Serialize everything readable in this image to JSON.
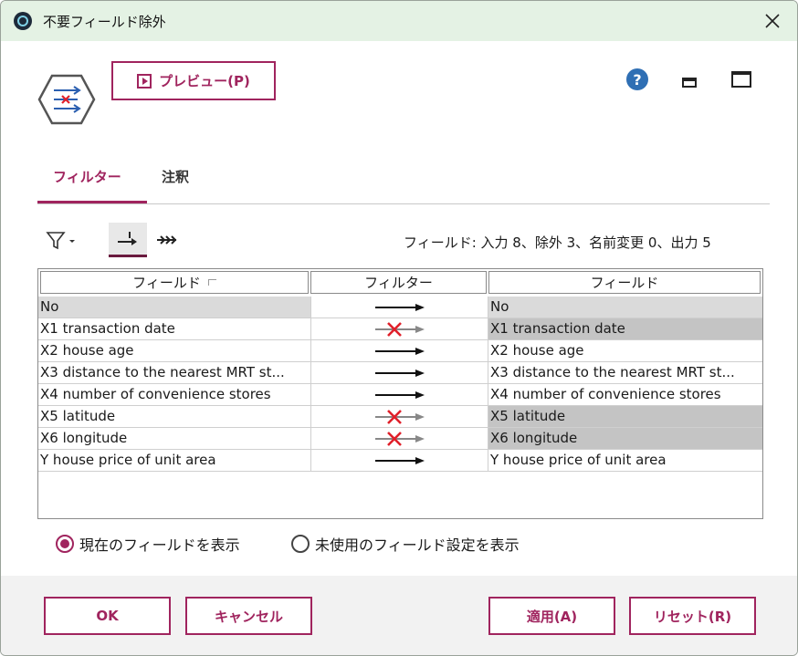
{
  "window": {
    "title": "不要フィールド除外"
  },
  "toolbar": {
    "preview_label": "プレビュー(P)",
    "help_glyph": "?"
  },
  "tabs": [
    {
      "label": "フィルター",
      "active": true
    },
    {
      "label": "注釈",
      "active": false
    }
  ],
  "summary": "フィールド: 入力 8、除外 3、名前変更 0、出力 5",
  "table": {
    "headers": [
      "フィールド",
      "フィルター",
      "フィールド"
    ],
    "rows": [
      {
        "input": "No",
        "excluded": false,
        "output": "No"
      },
      {
        "input": "X1 transaction date",
        "excluded": true,
        "output": "X1 transaction date"
      },
      {
        "input": "X2 house age",
        "excluded": false,
        "output": "X2 house age"
      },
      {
        "input": "X3 distance to the nearest MRT st...",
        "excluded": false,
        "output": "X3 distance to the nearest MRT st..."
      },
      {
        "input": "X4 number of convenience stores",
        "excluded": false,
        "output": "X4 number of convenience stores"
      },
      {
        "input": "X5 latitude",
        "excluded": true,
        "output": "X5 latitude"
      },
      {
        "input": "X6 longitude",
        "excluded": true,
        "output": "X6 longitude"
      },
      {
        "input": "Y house price of unit area",
        "excluded": false,
        "output": "Y house price of unit area"
      }
    ]
  },
  "radios": [
    {
      "label": "現在のフィールドを表示",
      "selected": true
    },
    {
      "label": "未使用のフィールド設定を表示",
      "selected": false
    }
  ],
  "buttons": {
    "ok": "OK",
    "cancel": "キャンセル",
    "apply": "適用(A)",
    "reset": "リセット(R)"
  },
  "colors": {
    "accent": "#a0245e",
    "title_bar": "#e4f2e4",
    "excluded_row": "#c4c4c4",
    "cross": "#e0202a"
  }
}
